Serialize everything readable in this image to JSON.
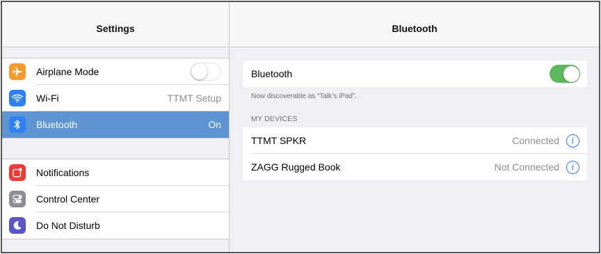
{
  "master": {
    "title": "Settings",
    "group1": [
      {
        "label": "Airplane Mode",
        "icon": "airplane-icon",
        "icon_color": "#f79a2d",
        "control": "switch-off"
      },
      {
        "label": "Wi-Fi",
        "icon": "wifi-icon",
        "icon_color": "#2f7ff5",
        "value": "TTMT Setup"
      },
      {
        "label": "Bluetooth",
        "icon": "bluetooth-icon",
        "icon_color": "#2f7ff5",
        "value": "On",
        "selected": true
      }
    ],
    "group2": [
      {
        "label": "Notifications",
        "icon": "notifications-icon",
        "icon_color": "#f03a35"
      },
      {
        "label": "Control Center",
        "icon": "control-center-icon",
        "icon_color": "#8e8e93"
      },
      {
        "label": "Do Not Disturb",
        "icon": "moon-icon",
        "icon_color": "#5a56c7"
      }
    ]
  },
  "detail": {
    "title": "Bluetooth",
    "bluetooth_label": "Bluetooth",
    "bluetooth_on": true,
    "discoverable_note": "Now discoverable as “Talk’s iPad”.",
    "section_header": "MY DEVICES",
    "devices": [
      {
        "name": "TTMT SPKR",
        "status": "Connected"
      },
      {
        "name": "ZAGG Rugged Book",
        "status": "Not Connected"
      }
    ]
  },
  "colors": {
    "selected_row": "#5d95d2",
    "switch_on": "#5cb85c",
    "info_accent": "#2d7cf6"
  }
}
